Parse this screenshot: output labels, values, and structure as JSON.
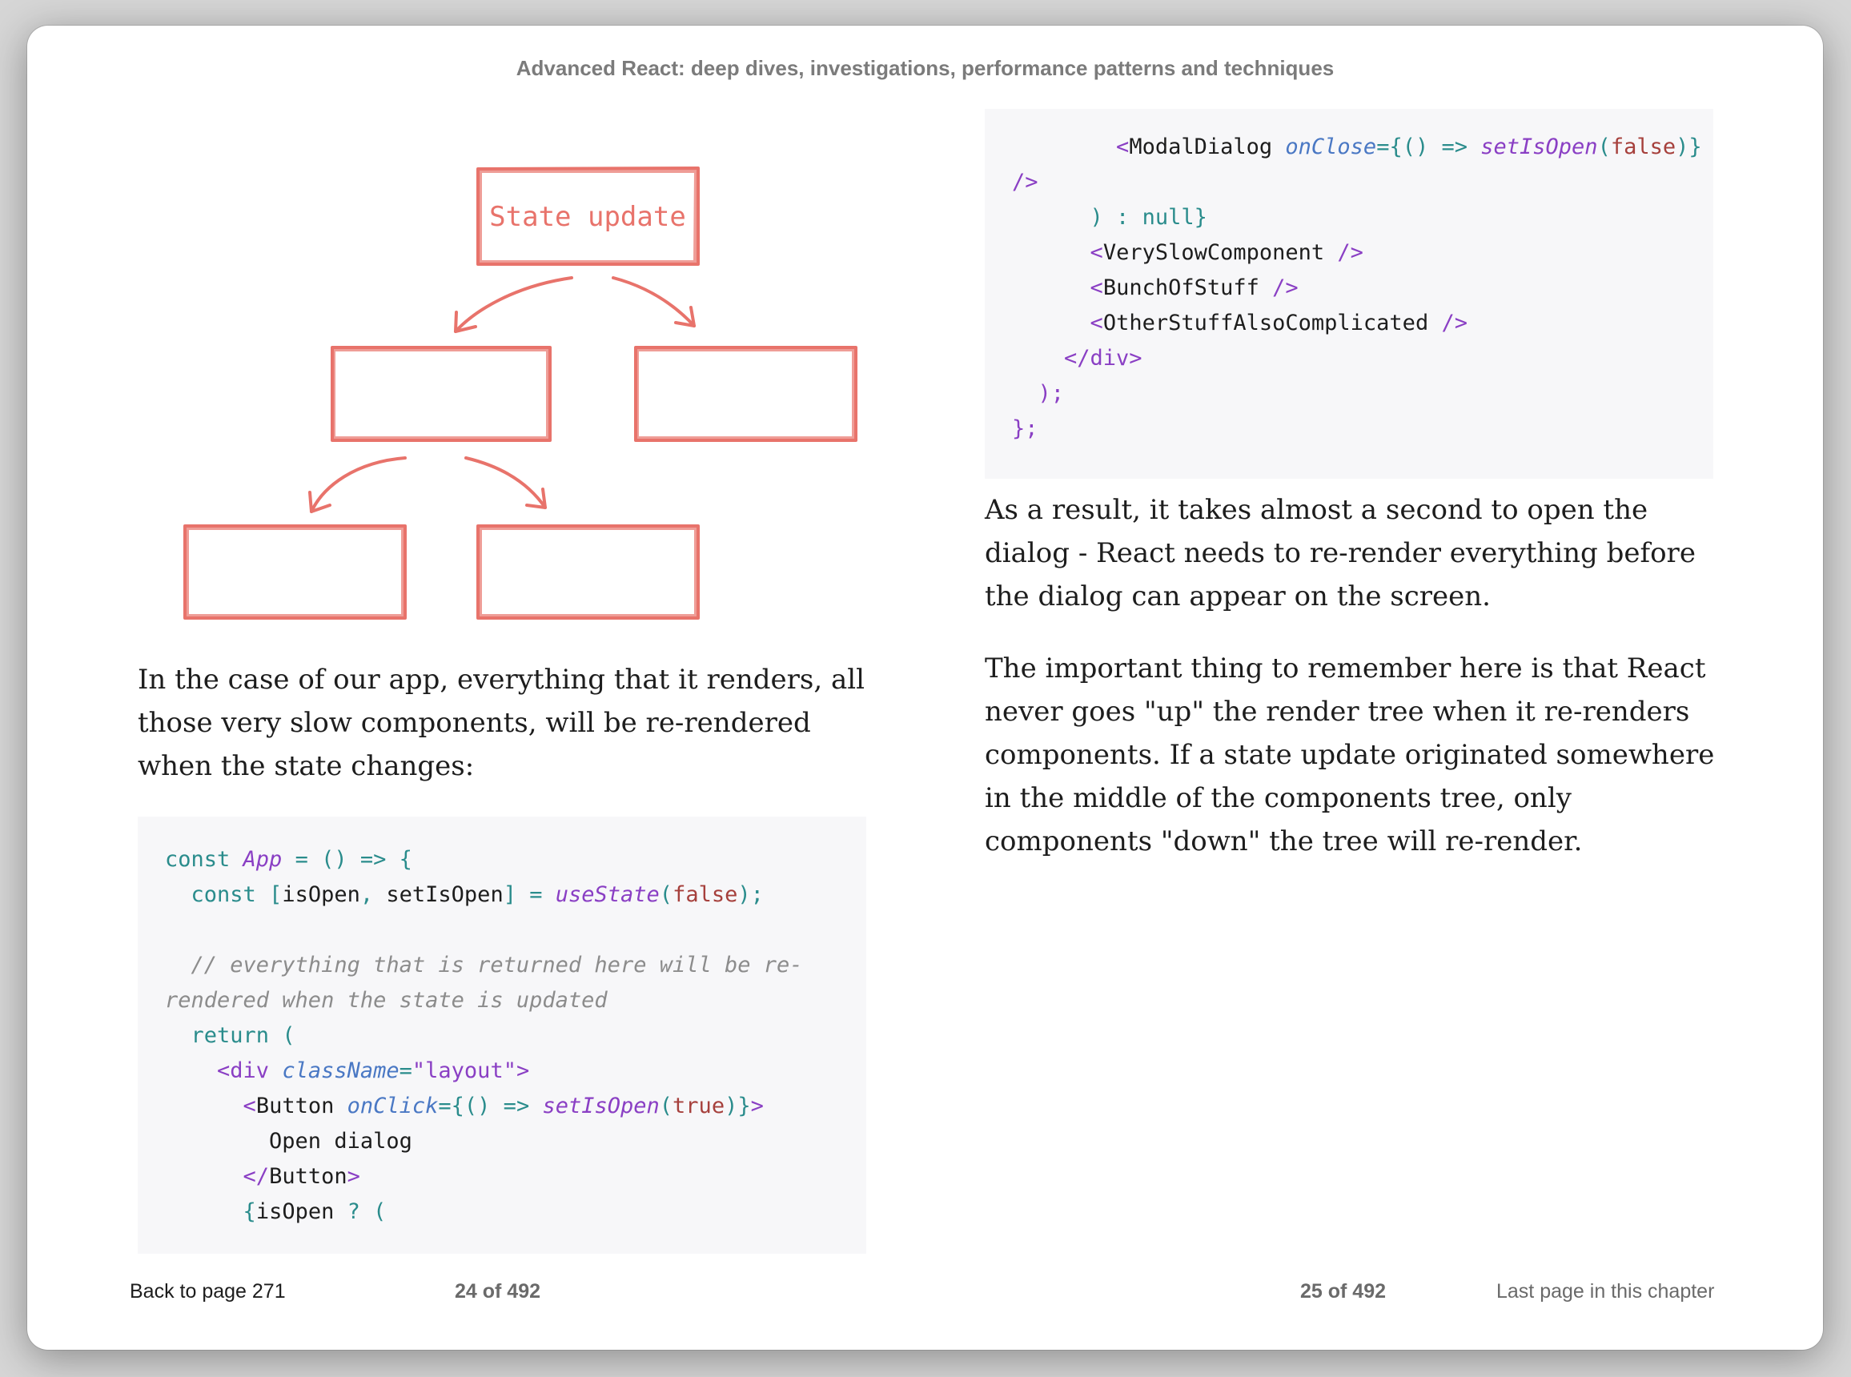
{
  "book": {
    "title": "Advanced React: deep dives, investigations, performance patterns and techniques"
  },
  "diagram": {
    "root_label": "State update",
    "stroke_color": "#e8736b"
  },
  "left_page": {
    "paragraph": "In the case of our app, everything that it renders, all those very slow components, will be re-rendered when the state changes:",
    "code_lines": [
      "const App = () => {",
      "  const [isOpen, setIsOpen] = useState(false);",
      "",
      "  // everything that is returned here will be re-",
      "rendered when the state is updated",
      "  return (",
      "    <div className=\"layout\">",
      "      <Button onClick={() => setIsOpen(true)}>",
      "        Open dialog",
      "      </Button>",
      "      {isOpen ? ("
    ]
  },
  "right_page": {
    "code_lines": [
      "        <ModalDialog onClose={() => setIsOpen(false)}",
      "/>",
      "      ) : null}",
      "      <VerySlowComponent />",
      "      <BunchOfStuff />",
      "      <OtherStuffAlsoComplicated />",
      "    </div>",
      "  );",
      "};"
    ],
    "paragraph1": "As a result, it takes almost a second to open the dialog - React needs to re-render everything before the dialog can appear on the screen.",
    "paragraph2": "The important thing to remember here is that React never goes \"up\" the render tree when it re-renders components. If a state update originated somewhere in the middle of the components tree, only components \"down\" the tree will re-render."
  },
  "footer": {
    "back_link": "Back to page 271",
    "left_page_number": "24 of 492",
    "right_page_number": "25 of 492",
    "chapter_note": "Last page in this chapter"
  }
}
